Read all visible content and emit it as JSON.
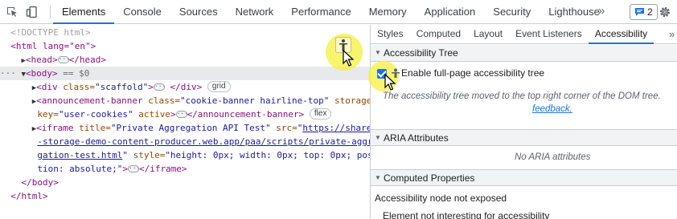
{
  "toolbar": {
    "tabs": [
      "Elements",
      "Console",
      "Sources",
      "Network",
      "Performance",
      "Memory",
      "Application",
      "Security",
      "Lighthouse"
    ],
    "more_label": "»",
    "issues_count": "2",
    "icons": [
      "inspect-element-icon",
      "device-toolbar-icon",
      "issues-icon",
      "gear-icon",
      "more-tabs-icon"
    ]
  },
  "dom": {
    "doctype": "<!DOCTYPE html>",
    "html_open": "<html lang=\"en\">",
    "head": {
      "open": "<head>",
      "close": "</head>"
    },
    "body_open": "<body>",
    "body_eq": "== $0",
    "div": {
      "tag": "<div",
      "attr": " class=",
      "val": "\"scaffold\"",
      "end": ">",
      "close": "</div>",
      "pill": "grid"
    },
    "banner": {
      "line1_tag": "<announcement-banner",
      "line1_a1": " class=",
      "line1_v1": "\"cookie-banner hairline-top\"",
      "line1_a2": " storage-",
      "line2_a2": "key=",
      "line2_v2": "\"user-cookies\"",
      "line2_a3": " active",
      "line2_end": ">",
      "close": "</announcement-banner>",
      "pill": "flex"
    },
    "iframe": {
      "tag": "<iframe",
      "a1": " title=",
      "v1": "\"Private Aggregation API Test\"",
      "a2": " src=",
      "q": "\"",
      "link1": "https://shared",
      "link2": "-storage-demo-content-producer.web.app/paa/scripts/private-aggre",
      "link3": "gation-test.html",
      "q2": "\"",
      "a3": " style=",
      "v3a": "\"height: 0px; width: 0px; top: 0px; posi",
      "v3b": "tion: absolute;\"",
      "end": ">",
      "close": "</iframe>"
    },
    "body_close": "</body>",
    "html_close": "</html>"
  },
  "sidebar": {
    "tabs": [
      "Styles",
      "Computed",
      "Layout",
      "Event Listeners",
      "Accessibility"
    ],
    "more_label": "»",
    "sections": {
      "tree": {
        "title": "Accessibility Tree",
        "checkbox_label": "Enable full-page accessibility tree",
        "checked": true,
        "note": "The accessibility tree moved to the top right corner of the DOM tree.",
        "link": "feedback."
      },
      "aria": {
        "title": "ARIA Attributes",
        "empty": "No ARIA attributes"
      },
      "computed": {
        "title": "Computed Properties",
        "line1": "Accessibility node not exposed",
        "line2": "Element not interesting for accessibility"
      }
    }
  },
  "colors": {
    "accent": "#1a73e8",
    "tag": "#881280",
    "attr_name": "#994500",
    "attr_value": "#1a1aa6",
    "highlight": "#f5f03c"
  }
}
